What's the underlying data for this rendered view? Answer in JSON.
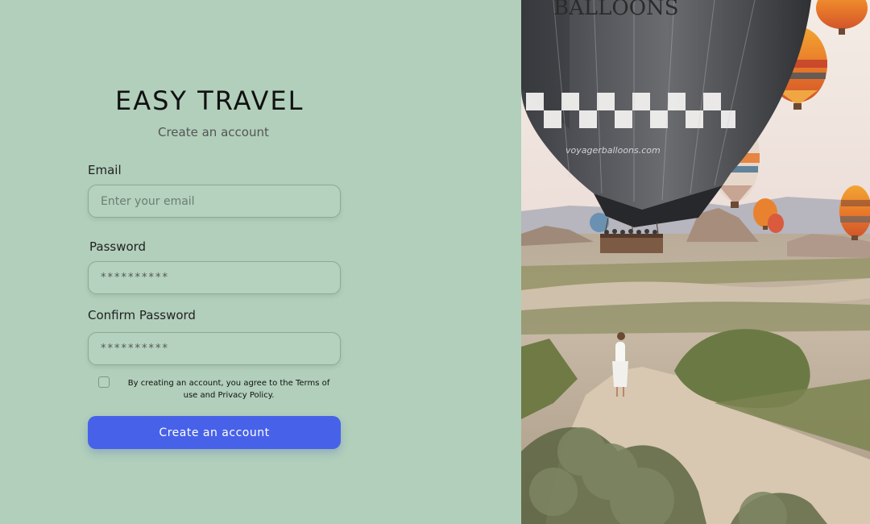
{
  "brand": {
    "title": "EASY TRAVEL",
    "subtitle": "Create an account"
  },
  "form": {
    "email": {
      "label": "Email",
      "placeholder": "Enter your email"
    },
    "password": {
      "label": "Password",
      "placeholder": "**********"
    },
    "confirm_password": {
      "label": "Confirm Password",
      "placeholder": "**********"
    },
    "terms": {
      "checked": false,
      "text": "By creating an account, you agree to the Terms of use and Privacy Policy."
    },
    "submit_label": "Create an account"
  },
  "hero": {
    "balloon_text": "BALLOONS",
    "balloon_url": "voyagerballoons.com"
  },
  "colors": {
    "background": "#b1cfbb",
    "accent": "#4762e8"
  }
}
